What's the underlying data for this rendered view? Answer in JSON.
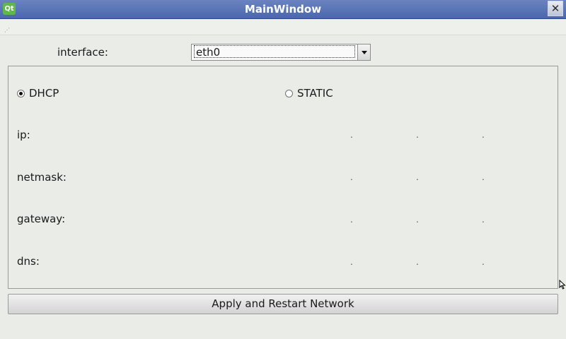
{
  "window": {
    "title": "MainWindow",
    "app_icon_text": "Qt",
    "close_glyph": "✕"
  },
  "interface": {
    "label": "interface:",
    "selected": "eth0"
  },
  "mode": {
    "dhcp_label": "DHCP",
    "static_label": "STATIC",
    "selected": "DHCP"
  },
  "fields": [
    {
      "label": "ip:"
    },
    {
      "label": "netmask:"
    },
    {
      "label": "gateway:"
    },
    {
      "label": "dns:"
    }
  ],
  "ip_separator": ".",
  "apply_button": "Apply and Restart Network"
}
